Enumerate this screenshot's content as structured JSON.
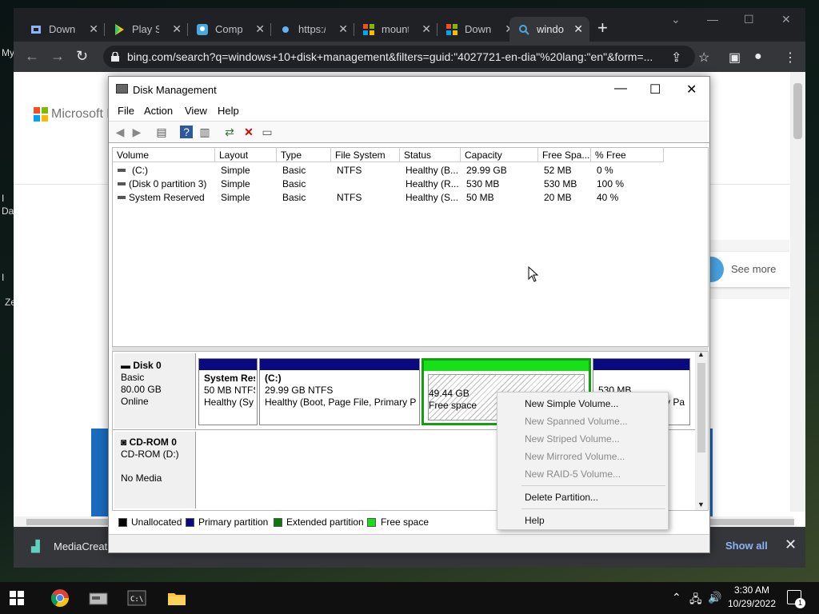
{
  "browser": {
    "tabs": [
      {
        "title": "Downl",
        "favicon": "download-page-icon",
        "color": "#8ab4f8"
      },
      {
        "title": "Play S",
        "favicon": "play-store-icon",
        "color": "#f1c40f"
      },
      {
        "title": "Compr",
        "favicon": "map-pin-icon",
        "color": "#4aa8e0"
      },
      {
        "title": "https:/",
        "favicon": "globe-icon",
        "color": "#5fb3f9"
      },
      {
        "title": "mount",
        "favicon": "microsoft-icon",
        "color": "#f25022"
      },
      {
        "title": "Downl",
        "favicon": "microsoft-icon",
        "color": "#f25022"
      },
      {
        "title": "windo",
        "favicon": "search-icon",
        "color": "#4aa8e0",
        "active": true
      }
    ],
    "address": "bing.com/search?q=windows+10+disk+management&filters=guid:\"4027721-en-dia\"%20lang:\"en\"&form=...",
    "page": {
      "brand": "Microsoft B",
      "see_more": "See more",
      "left_fragments": [
        "My",
        "I",
        "Da",
        "I",
        "Ze"
      ]
    },
    "download_bar": {
      "file": "MediaCreati",
      "show_all": "Show all"
    }
  },
  "disk_mgmt": {
    "title": "Disk Management",
    "menu": [
      "File",
      "Action",
      "View",
      "Help"
    ],
    "columns": [
      "Volume",
      "Layout",
      "Type",
      "File System",
      "Status",
      "Capacity",
      "Free Spa...",
      "% Free"
    ],
    "volumes": [
      [
        "(C:)",
        "Simple",
        "Basic",
        "NTFS",
        "Healthy (B...",
        "29.99 GB",
        "52 MB",
        "0 %"
      ],
      [
        "(Disk 0 partition 3)",
        "Simple",
        "Basic",
        "",
        "Healthy (R...",
        "530 MB",
        "530 MB",
        "100 %"
      ],
      [
        "System Reserved",
        "Simple",
        "Basic",
        "NTFS",
        "Healthy (S...",
        "50 MB",
        "20 MB",
        "40 %"
      ]
    ],
    "disk0": {
      "name": "Disk 0",
      "type": "Basic",
      "size": "80.00 GB",
      "state": "Online",
      "partitions": [
        {
          "name": "System Res",
          "size": "50 MB NTFS",
          "status": "Healthy (Sy"
        },
        {
          "name": "(C:)",
          "size": "29.99 GB NTFS",
          "status": "Healthy (Boot, Page File, Primary Pa"
        },
        {
          "name": "",
          "size": "49.44 GB",
          "status": "Free space"
        },
        {
          "name": "",
          "size": "530 MB",
          "status": "y Pa"
        }
      ]
    },
    "cdrom": {
      "name": "CD-ROM 0",
      "drive": "CD-ROM (D:)",
      "media": "No Media"
    },
    "legend": [
      {
        "label": "Unallocated",
        "color": "#000000"
      },
      {
        "label": "Primary partition",
        "color": "#0a0a80"
      },
      {
        "label": "Extended partition",
        "color": "#0a7a0a"
      },
      {
        "label": "Free space",
        "color": "#18e018"
      }
    ],
    "context_menu": {
      "items": [
        {
          "label": "New Simple Volume...",
          "enabled": true
        },
        {
          "label": "New Spanned Volume...",
          "enabled": false
        },
        {
          "label": "New Striped Volume...",
          "enabled": false
        },
        {
          "label": "New Mirrored Volume...",
          "enabled": false
        },
        {
          "label": "New RAID-5 Volume...",
          "enabled": false
        },
        {
          "label": "Delete Partition...",
          "enabled": true
        },
        {
          "label": "Help",
          "enabled": true
        }
      ]
    }
  },
  "taskbar": {
    "time": "3:30 AM",
    "date": "10/29/2022",
    "notifications": "1"
  }
}
